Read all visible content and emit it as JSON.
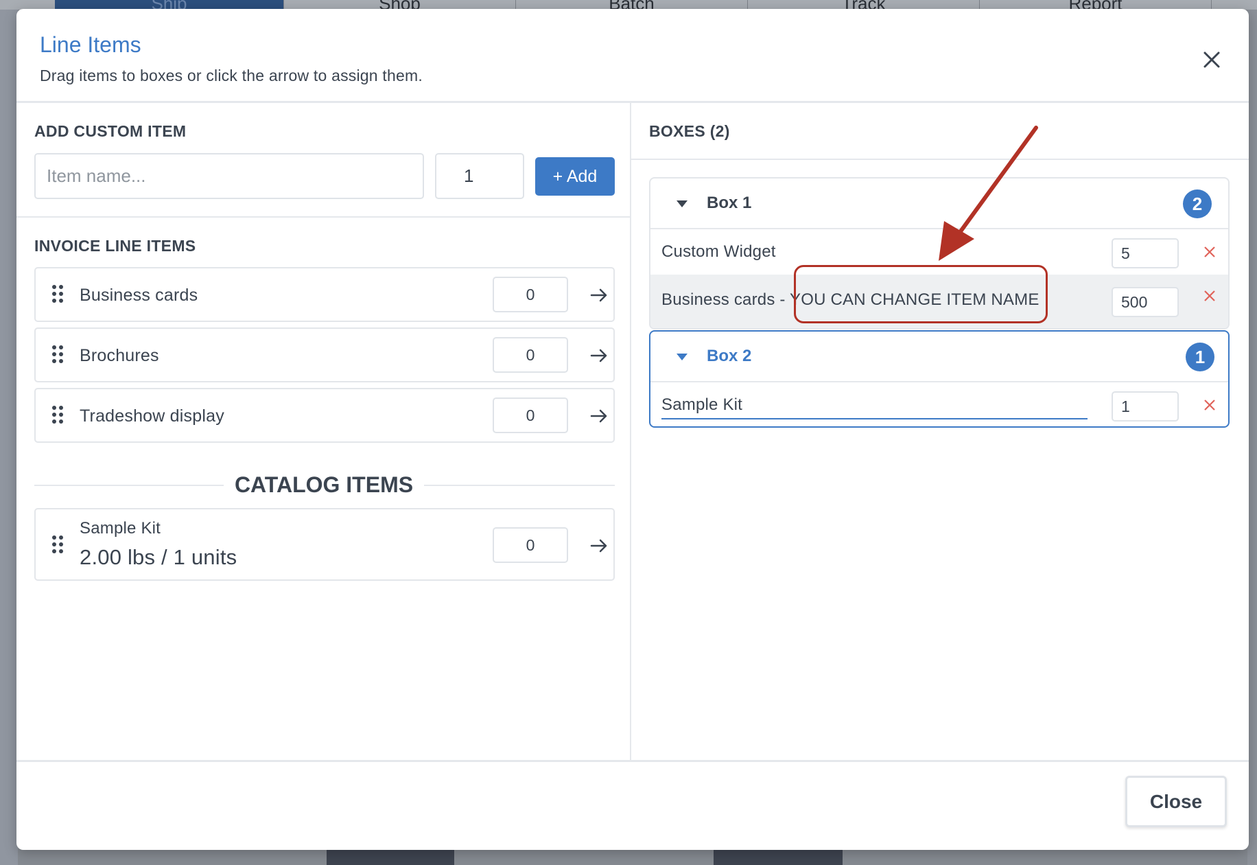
{
  "background_tabs": [
    "Ship",
    "Shop",
    "Batch",
    "Track",
    "Report"
  ],
  "modal": {
    "title": "Line Items",
    "subtitle": "Drag items to boxes or click the arrow to assign them.",
    "close_icon": "close-icon"
  },
  "custom_item": {
    "heading": "ADD CUSTOM ITEM",
    "name_placeholder": "Item name...",
    "qty_value": "1",
    "add_label": "+ Add"
  },
  "invoice": {
    "heading": "INVOICE LINE ITEMS",
    "items": [
      {
        "name": "Business cards",
        "qty": "0"
      },
      {
        "name": "Brochures",
        "qty": "0"
      },
      {
        "name": "Tradeshow display",
        "qty": "0"
      }
    ]
  },
  "catalog": {
    "heading": "CATALOG ITEMS",
    "items": [
      {
        "name": "Sample Kit",
        "detail": "2.00 lbs / 1 units",
        "qty": "0"
      }
    ]
  },
  "boxes": {
    "heading": "BOXES (2)",
    "list": [
      {
        "name": "Box 1",
        "count": "2",
        "rows": [
          {
            "name": "Custom Widget",
            "qty": "5"
          },
          {
            "name": "Business cards - YOU CAN CHANGE ITEM NAME",
            "qty": "500"
          }
        ]
      },
      {
        "name": "Box 2",
        "count": "1",
        "rows": [
          {
            "name": "Sample Kit",
            "qty": "1"
          }
        ]
      }
    ]
  },
  "footer": {
    "close_label": "Close"
  },
  "colors": {
    "accent": "#3d7ac6",
    "annotation": "#b23226",
    "remove": "#e0635a",
    "text": "#3b4450"
  }
}
